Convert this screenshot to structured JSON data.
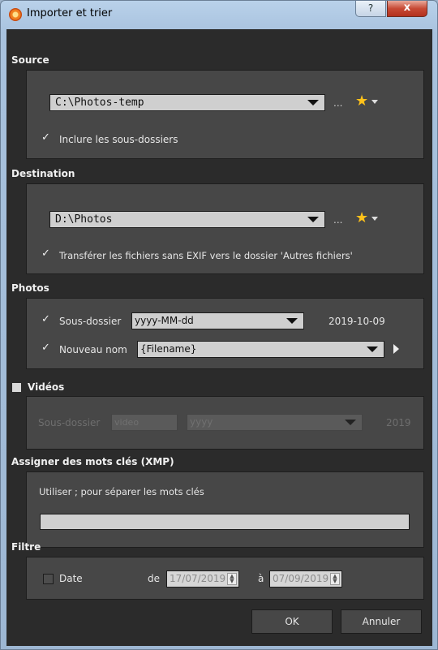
{
  "window": {
    "title": "Importer et trier",
    "help": "?",
    "close": "x"
  },
  "source": {
    "title": "Source",
    "path": "C:\\Photos-temp",
    "browse": "...",
    "include_subfolders": "Inclure les sous-dossiers",
    "include_subfolders_checked": true
  },
  "destination": {
    "title": "Destination",
    "path": "D:\\Photos",
    "browse": "...",
    "transfer_no_exif": "Transférer les fichiers sans EXIF vers le dossier 'Autres fichiers'",
    "transfer_no_exif_checked": true
  },
  "photos": {
    "title": "Photos",
    "subfolder_label": "Sous-dossier",
    "subfolder_format": "yyyy-MM-dd",
    "subfolder_preview": "2019-10-09",
    "rename_label": "Nouveau nom",
    "rename_pattern": "{Filename}"
  },
  "videos": {
    "title": "Vidéos",
    "enabled": false,
    "subfolder_label": "Sous-dossier",
    "subfolder_name": "video",
    "subfolder_format": "yyyy",
    "subfolder_preview": "2019"
  },
  "keywords": {
    "title": "Assigner des mots clés (XMP)",
    "hint": "Utiliser ; pour séparer les mots clés",
    "value": ""
  },
  "filter": {
    "title": "Filtre",
    "date_label": "Date",
    "date_checked": false,
    "from_label": "de",
    "from_date": "17/07/2019",
    "to_label": "à",
    "to_date": "07/09/2019"
  },
  "buttons": {
    "ok": "OK",
    "cancel": "Annuler"
  },
  "colors": {
    "star": "#ffc21a",
    "panel": "#474747",
    "background": "#2b2b2b"
  }
}
